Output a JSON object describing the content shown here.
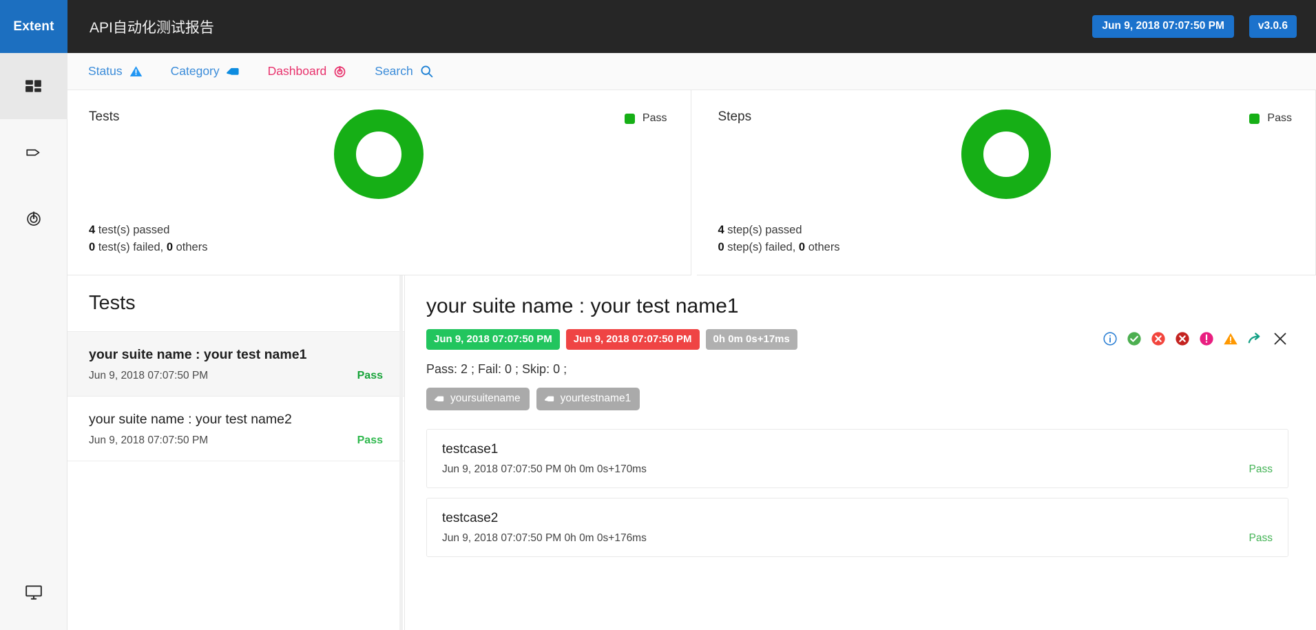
{
  "topbar": {
    "brand": "Extent",
    "report_title": "API自动化测试报告",
    "timestamp": "Jun 9, 2018 07:07:50 PM",
    "version": "v3.0.6",
    "brand_color": "#1c6fc0",
    "bar_color": "#262626"
  },
  "rail": {
    "items": [
      {
        "name": "dashboard-grid-icon",
        "active": true
      },
      {
        "name": "tag-icon",
        "active": false
      },
      {
        "name": "target-icon",
        "active": false
      }
    ],
    "bottom_item": {
      "name": "monitor-icon"
    }
  },
  "nav": {
    "tabs": [
      {
        "label": "Status",
        "icon": "warning-triangle-icon",
        "active": false,
        "color": "#3b8cd9"
      },
      {
        "label": "Category",
        "icon": "tag-icon",
        "active": false,
        "color": "#3b8cd9"
      },
      {
        "label": "Dashboard",
        "icon": "target-icon",
        "active": true,
        "color": "#e8336d"
      },
      {
        "label": "Search",
        "icon": "search-icon",
        "active": false,
        "color": "#3b8cd9"
      }
    ]
  },
  "cards": [
    {
      "title": "Tests",
      "legend_label": "Pass",
      "legend_color": "#16af16",
      "passed_count": "4",
      "passed_text": "test(s) passed",
      "failed_count": "0",
      "failed_text": "test(s) failed,",
      "others_count": "0",
      "others_text": "others"
    },
    {
      "title": "Steps",
      "legend_label": "Pass",
      "legend_color": "#16af16",
      "passed_count": "4",
      "passed_text": "step(s) passed",
      "failed_count": "0",
      "failed_text": "step(s) failed,",
      "others_count": "0",
      "others_text": "others"
    }
  ],
  "chart_data": [
    {
      "type": "pie",
      "title": "Tests",
      "labels": [
        "Pass"
      ],
      "values": [
        4
      ],
      "colors": [
        "#16af16"
      ],
      "legend_position": "top-right",
      "donut": true,
      "annotations": [
        "4 test(s) passed",
        "0 test(s) failed, 0 others"
      ]
    },
    {
      "type": "pie",
      "title": "Steps",
      "labels": [
        "Pass"
      ],
      "values": [
        4
      ],
      "colors": [
        "#16af16"
      ],
      "legend_position": "top-right",
      "donut": true,
      "annotations": [
        "4 step(s) passed",
        "0 step(s) failed, 0 others"
      ]
    }
  ],
  "tests_panel": {
    "header": "Tests",
    "items": [
      {
        "name": "your suite name : your test name1",
        "time": "Jun 9, 2018 07:07:50 PM",
        "status": "Pass",
        "selected": true
      },
      {
        "name": "your suite name : your test name2",
        "time": "Jun 9, 2018 07:07:50 PM",
        "status": "Pass",
        "selected": false
      }
    ]
  },
  "detail": {
    "title": "your suite name : your test name1",
    "badge_start": "Jun 9, 2018 07:07:50 PM",
    "badge_end": "Jun 9, 2018 07:07:50 PM",
    "badge_duration": "0h 0m 0s+17ms",
    "counts": "Pass: 2 ; Fail: 0 ; Skip: 0 ;",
    "tags": [
      "yoursuitename",
      "yourtestname1"
    ],
    "action_icons": [
      "info-circle-icon",
      "check-circle-icon",
      "error-circle-icon",
      "fail-circle-icon",
      "warning-circle-icon",
      "warning-triangle-icon",
      "skip-arrow-icon",
      "close-icon"
    ],
    "nodes": [
      {
        "name": "testcase1",
        "time": "Jun 9, 2018 07:07:50 PM 0h 0m 0s+170ms",
        "status": "Pass"
      },
      {
        "name": "testcase2",
        "time": "Jun 9, 2018 07:07:50 PM 0h 0m 0s+176ms",
        "status": "Pass"
      }
    ]
  }
}
